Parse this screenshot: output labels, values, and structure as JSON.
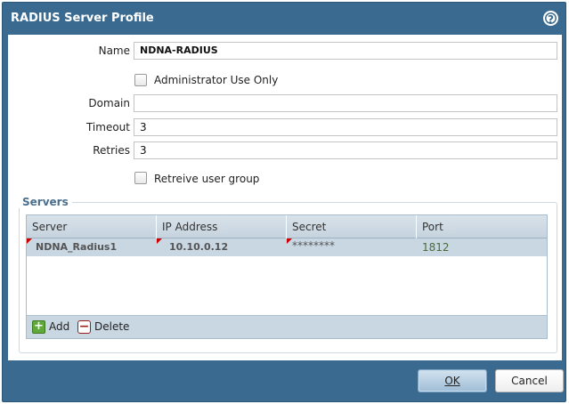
{
  "dialog": {
    "title": "RADIUS Server Profile",
    "help_icon": "?"
  },
  "form": {
    "name_label": "Name",
    "name_value": "NDNA-RADIUS",
    "admin_only_label": "Administrator Use Only",
    "admin_only_checked": false,
    "domain_label": "Domain",
    "domain_value": "",
    "timeout_label": "Timeout",
    "timeout_value": "3",
    "retries_label": "Retries",
    "retries_value": "3",
    "retrieve_group_label": "Retreive user group",
    "retrieve_group_checked": false
  },
  "servers": {
    "legend": "Servers",
    "columns": [
      "Server",
      "IP Address",
      "Secret",
      "Port"
    ],
    "rows": [
      {
        "server": "NDNA_Radius1",
        "ip": "10.10.0.12",
        "secret": "********",
        "port": "1812"
      }
    ],
    "add_label": "Add",
    "delete_label": "Delete"
  },
  "buttons": {
    "ok_label": "OK",
    "cancel_label": "Cancel"
  },
  "colors": {
    "title_bar": "#3a6a8f",
    "row_selected": "#c9d7e3",
    "accent_text": "#4a6f8e"
  }
}
